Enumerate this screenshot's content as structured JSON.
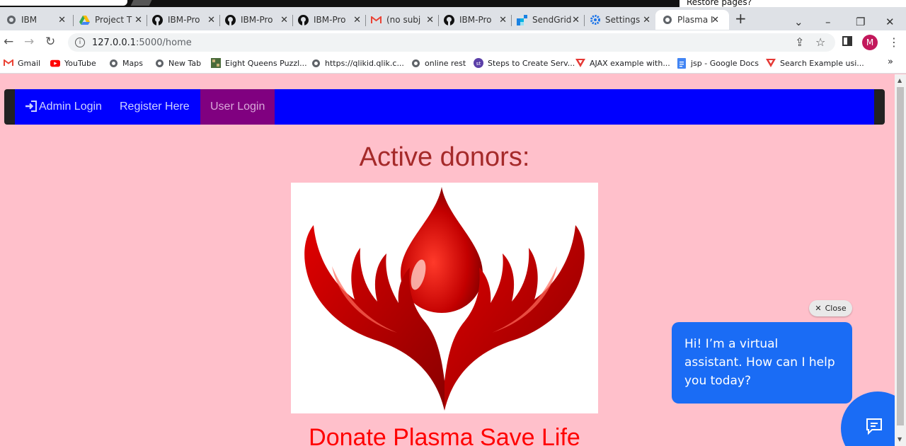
{
  "top": {
    "restore_text": "Restore pages?"
  },
  "tabs": [
    {
      "label": "IBM",
      "icon": "globe-icon"
    },
    {
      "label": "Project T",
      "icon": "drive-icon"
    },
    {
      "label": "IBM-Pro",
      "icon": "github-icon"
    },
    {
      "label": "IBM-Pro",
      "icon": "github-icon"
    },
    {
      "label": "IBM-Pro",
      "icon": "github-icon"
    },
    {
      "label": "(no subj",
      "icon": "gmail-icon"
    },
    {
      "label": "IBM-Pro",
      "icon": "github-icon"
    },
    {
      "label": "SendGrid",
      "icon": "sendgrid-icon"
    },
    {
      "label": "Settings",
      "icon": "gear-icon"
    },
    {
      "label": "Plasma I",
      "icon": "globe-icon",
      "active": true
    }
  ],
  "toolbar": {
    "url_host": "127.0.0.1",
    "url_path": ":5000/home",
    "profile_initial": "M"
  },
  "bookmarks": [
    {
      "label": "Gmail",
      "icon": "gmail-icon"
    },
    {
      "label": "YouTube",
      "icon": "youtube-icon"
    },
    {
      "label": "Maps",
      "icon": "globe-icon"
    },
    {
      "label": "New Tab",
      "icon": "globe-icon"
    },
    {
      "label": "Eight Queens Puzzl...",
      "icon": "image-icon"
    },
    {
      "label": "https://qlikid.qlik.c...",
      "icon": "globe-icon"
    },
    {
      "label": "online rest",
      "icon": "globe-icon"
    },
    {
      "label": "Steps to Create Serv...",
      "icon": "st-icon"
    },
    {
      "label": "AJAX example with...",
      "icon": "v-icon"
    },
    {
      "label": "jsp - Google Docs",
      "icon": "docs-icon"
    },
    {
      "label": "Search Example usi...",
      "icon": "v-icon"
    }
  ],
  "nav": {
    "admin_login": "Admin Login",
    "register": "Register Here",
    "user_login": "User Login"
  },
  "main": {
    "heading": "Active donors:",
    "tagline": "Donate Plasma Save Life"
  },
  "assistant": {
    "close_label": "Close",
    "message": "Hi! I’m a virtual assistant. How can I help you today?"
  },
  "colors": {
    "page_bg": "#ffc0cb",
    "navbar": "#0000ff",
    "active_nav": "#800080",
    "heading": "#a52a2a",
    "tagline": "#ff0000",
    "assistant": "#1a6cf5"
  }
}
